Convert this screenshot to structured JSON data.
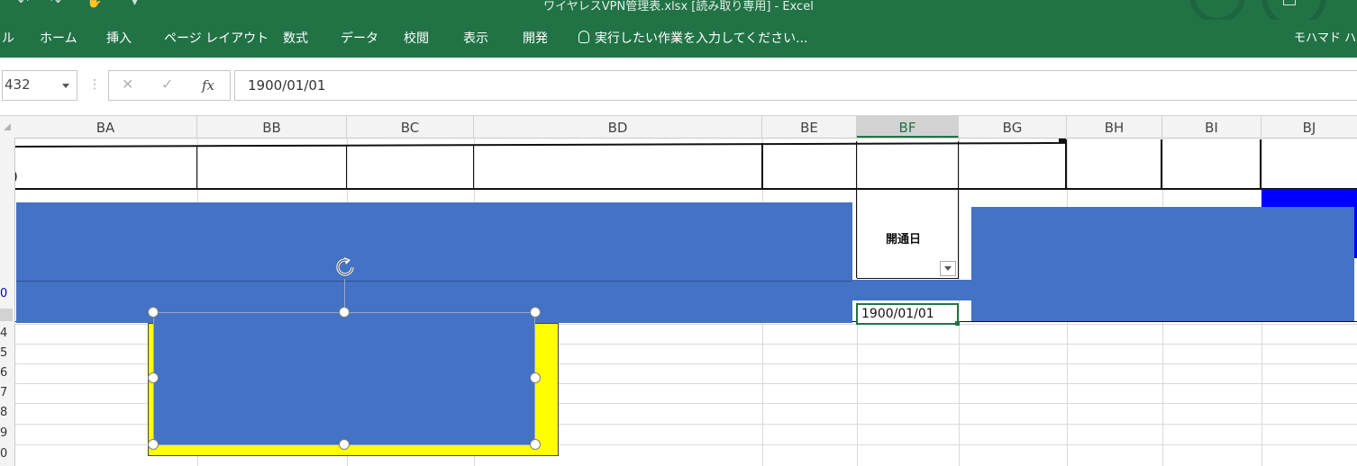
{
  "window": {
    "title": "ワイヤレスVPN管理表.xlsx [読み取り専用] - Excel"
  },
  "ribbon": {
    "tabs": [
      "ル",
      "ホーム",
      "挿入",
      "ページ レイアウト",
      "数式",
      "データ",
      "校閲",
      "表示",
      "開発"
    ],
    "tell_me": "実行したい作業を入力してください...",
    "user": "モハマド ハ"
  },
  "formula_bar": {
    "name_box": "432",
    "cancel": "✕",
    "enter": "✓",
    "fx": "fx",
    "value": "1900/01/01"
  },
  "columns": [
    "BA",
    "BB",
    "BC",
    "BD",
    "BE",
    "BF",
    "BG",
    "BH",
    "BI",
    "BJ"
  ],
  "active_column": "BF",
  "rows": [
    "0",
    "",
    "",
    "4",
    "5",
    "6",
    "7",
    "8",
    "9",
    "0"
  ],
  "sheet": {
    "header_label": "開通日",
    "row2_fragment": ")",
    "active_cell_value": "1900/01/01"
  },
  "colors": {
    "ribbon_green": "#217346",
    "shape_blue": "#4472c4",
    "highlight_yellow": "#ffff00",
    "fill_blue": "#0000ff"
  }
}
